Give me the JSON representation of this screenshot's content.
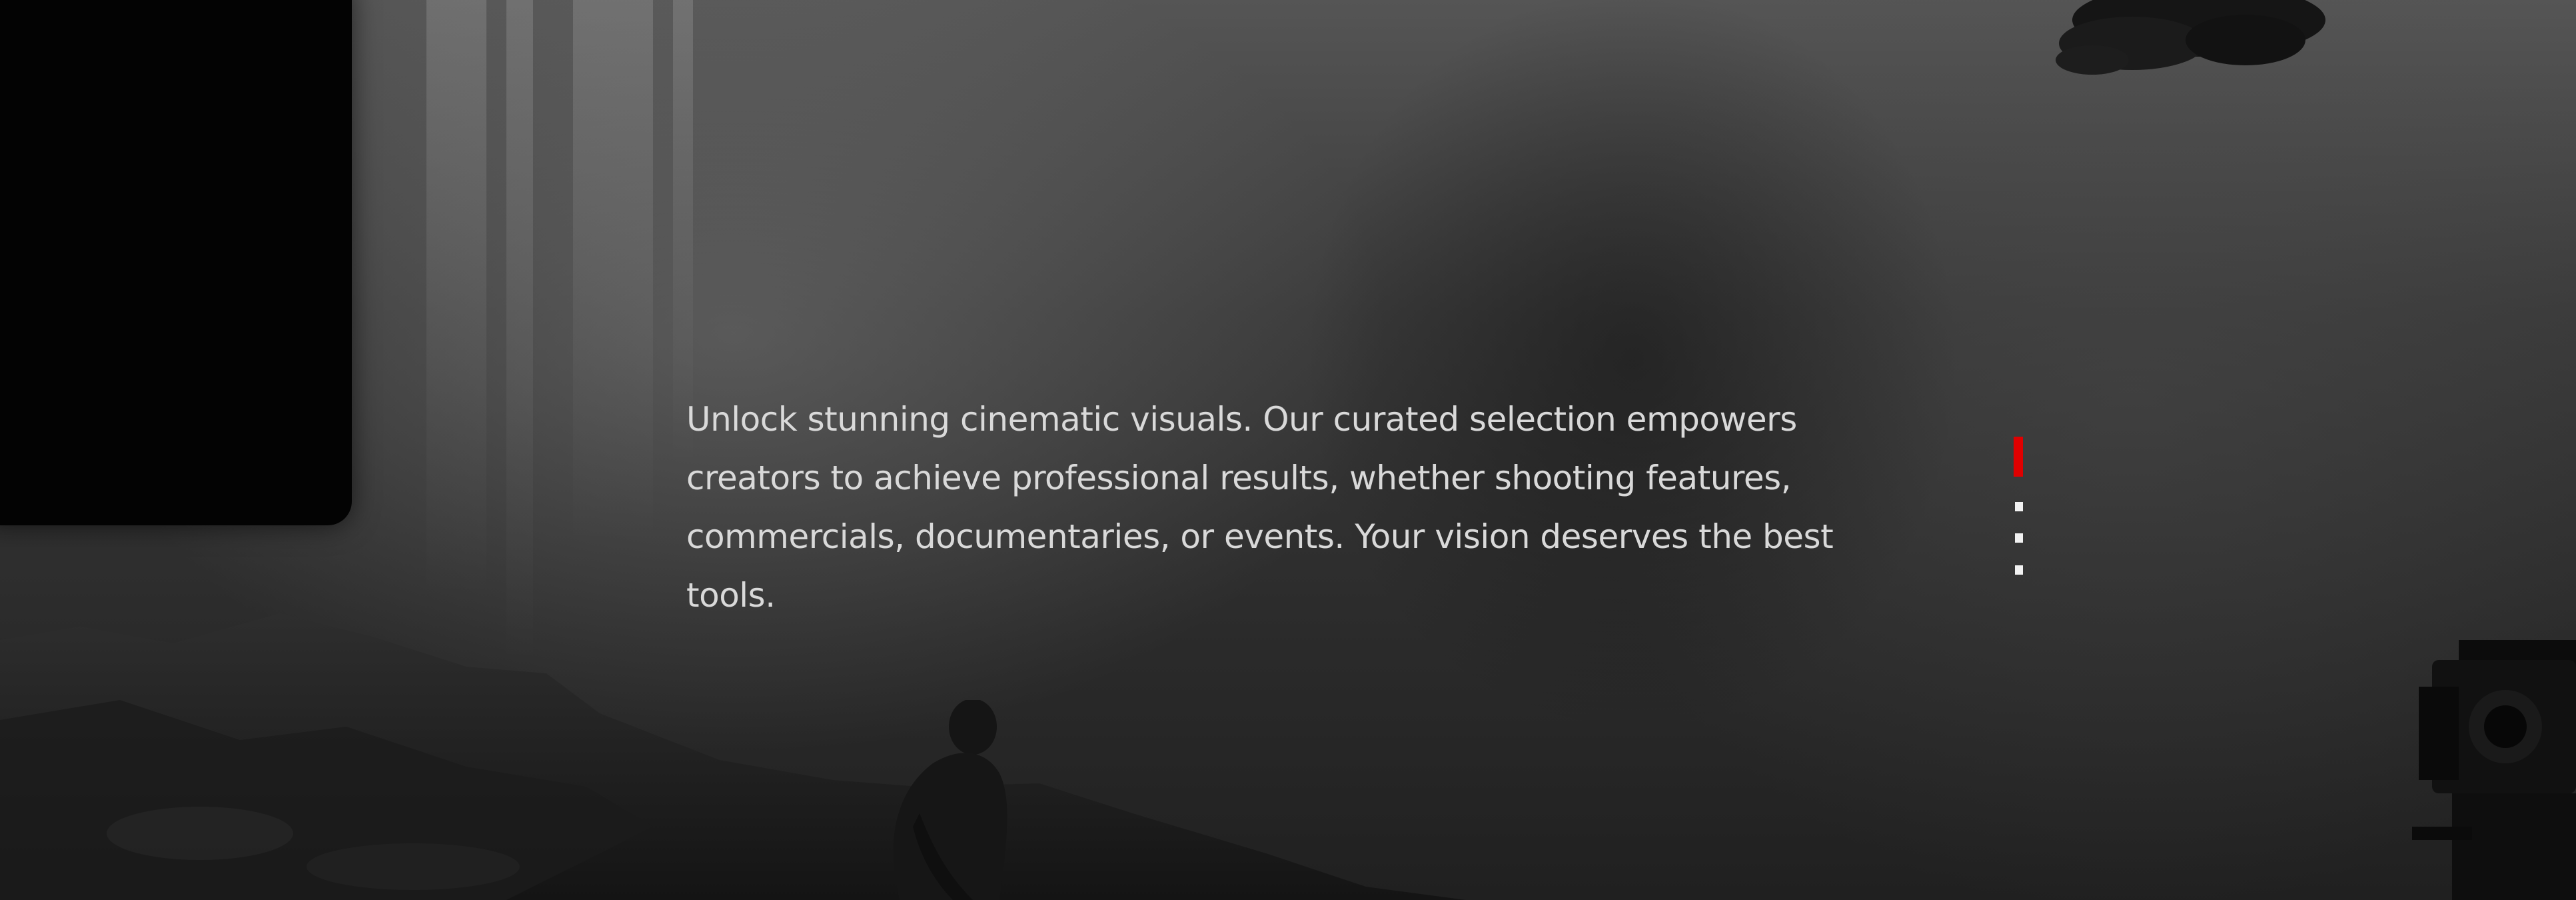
{
  "hero": {
    "description": "Unlock stunning cinematic visuals. Our curated selection empowers creators to achieve professional results, whether shooting features, commercials, documentaries, or events. Your vision deserves the best tools."
  },
  "slider": {
    "total": 4,
    "active_index": 0,
    "active_color": "#e00000",
    "inactive_color": "#f2f2f2"
  },
  "icons": {
    "photo_subject": "person-sitting-icon",
    "foreground_gear": "cinema-camera-icon",
    "foliage": "tree-branch-icon"
  }
}
